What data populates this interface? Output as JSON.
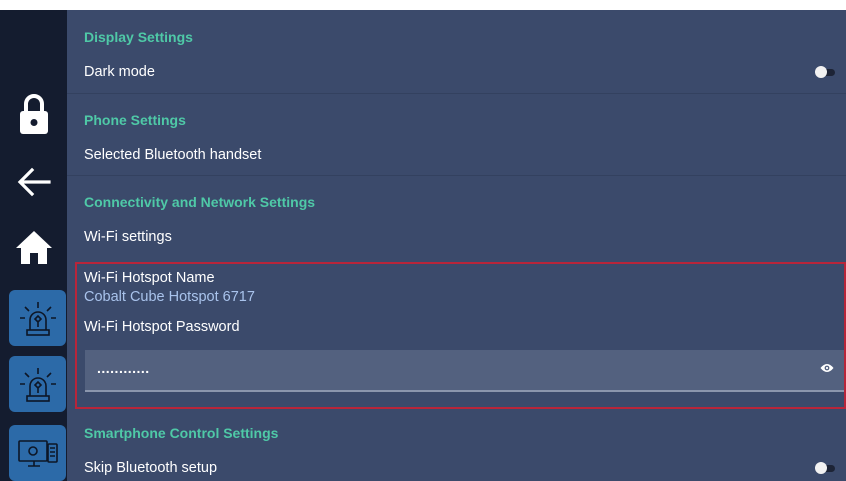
{
  "sidebar": {
    "buttons": [
      {
        "name": "lock",
        "icon": "lock-icon"
      },
      {
        "name": "back",
        "icon": "arrow-left-icon"
      },
      {
        "name": "home",
        "icon": "home-icon"
      },
      {
        "name": "alarm-1",
        "icon": "siren-icon"
      },
      {
        "name": "alarm-2",
        "icon": "siren-icon"
      },
      {
        "name": "screen-share",
        "icon": "monitor-phone-icon"
      }
    ]
  },
  "sections": {
    "display": {
      "heading": "Display Settings",
      "dark_mode_label": "Dark mode",
      "dark_mode_on": false
    },
    "phone": {
      "heading": "Phone Settings",
      "bluetooth_label": "Selected Bluetooth handset"
    },
    "connectivity": {
      "heading": "Connectivity and Network Settings",
      "wifi_label": "Wi-Fi settings",
      "hotspot_name_label": "Wi-Fi Hotspot Name",
      "hotspot_name_value": "Cobalt Cube Hotspot 6717",
      "hotspot_password_label": "Wi-Fi Hotspot Password",
      "hotspot_password_value": "............"
    },
    "smartphone": {
      "heading": "Smartphone Control Settings",
      "skip_bt_label": "Skip Bluetooth setup",
      "skip_bt_on": false
    }
  },
  "colors": {
    "accent": "#4fc9a7",
    "panel": "#3b4a6b",
    "sidebar": "#141c2f",
    "tile": "#2c6aa8",
    "highlight": "#b8253a"
  }
}
